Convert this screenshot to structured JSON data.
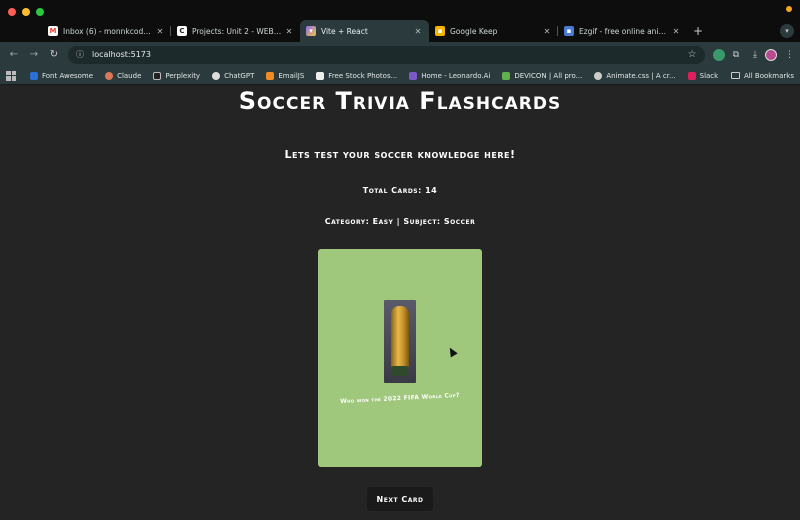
{
  "browser": {
    "tabs": [
      {
        "title": "Inbox (6) - monnkcode@gmail.com",
        "favicon": "gmail-icon",
        "color": "#ea4335"
      },
      {
        "title": "Projects: Unit 2 - WEB102 | Intro",
        "favicon": "codepath-icon",
        "color": "#ffffff"
      },
      {
        "title": "Vite + React",
        "favicon": "vite-icon",
        "color": "#8a6cf0",
        "active": true
      },
      {
        "title": "Google Keep",
        "favicon": "keep-icon",
        "color": "#f6b400"
      },
      {
        "title": "Ezgif - free online animated GIF",
        "favicon": "ezgif-icon",
        "color": "#4a7bd0"
      }
    ],
    "url": "localhost:5173",
    "bookmarks": [
      {
        "label": "Font Awesome",
        "color": "#2a6fd6"
      },
      {
        "label": "Claude",
        "color": "#d97757"
      },
      {
        "label": "Perplexity",
        "color": "#222222"
      },
      {
        "label": "ChatGPT",
        "color": "#dddddd"
      },
      {
        "label": "EmailJS",
        "color": "#f08a24"
      },
      {
        "label": "Free Stock Photos...",
        "color": "#eeeeee"
      },
      {
        "label": "Home - Leonardo.Ai",
        "color": "#7b5ac8"
      },
      {
        "label": "DEVICON | All pro...",
        "color": "#60b050"
      },
      {
        "label": "Animate.css | A cr...",
        "color": "#cccccc"
      },
      {
        "label": "Slack",
        "color": "#e01e5a"
      }
    ],
    "all_bookmarks": "All Bookmarks"
  },
  "page": {
    "title": "Soccer Trivia Flashcards",
    "subtitle": "Lets test your soccer knowledge here!",
    "total_cards": "Total Cards: 14",
    "category": "Category: Easy | Subject: Soccer",
    "card_question": "Who won the 2022 FIFA World Cup?",
    "card_color": "#a0c87d",
    "next_button": "Next Card"
  }
}
